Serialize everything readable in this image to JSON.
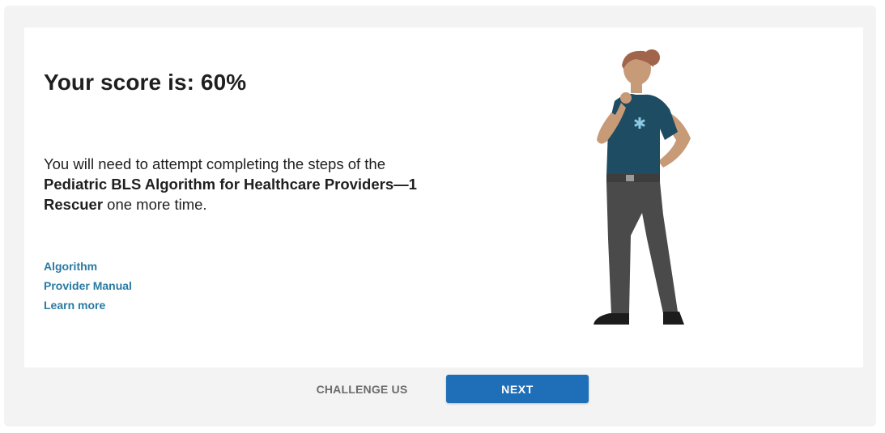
{
  "result": {
    "score_label": "Your score is: 60%",
    "message_pre": "You will need to attempt completing the steps of the ",
    "message_bold": "Pediatric BLS Algorithm for Healthcare Providers—1 Rescuer",
    "message_post": " one more time."
  },
  "links": {
    "algorithm": "Algorithm",
    "provider_manual": "Provider Manual",
    "learn_more": "Learn more"
  },
  "footer": {
    "challenge_label": "CHALLENGE US",
    "next_label": "NEXT"
  },
  "colors": {
    "accent": "#1f6fb8",
    "link": "#2a7aa3",
    "shirt": "#1e4d63",
    "pants": "#4a4a4a"
  }
}
